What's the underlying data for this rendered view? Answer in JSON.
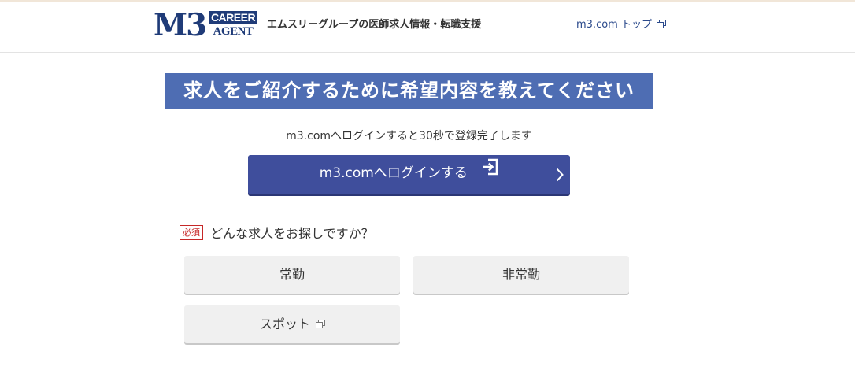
{
  "header": {
    "logo": {
      "main": "M3",
      "career": "CAREER",
      "agent": "AGENT"
    },
    "tagline": "エムスリーグループの医師求人情報・転職支援",
    "top_link": "m3.com トップ"
  },
  "banner": {
    "title": "求人をご紹介するために希望内容を教えてください"
  },
  "login": {
    "note": "m3.comへログインすると30秒で登録完了します",
    "button_label": "m3.comへログインする"
  },
  "question": {
    "required_badge": "必須",
    "text": "どんな求人をお探しですか？",
    "options": [
      {
        "label": "常勤"
      },
      {
        "label": "非常勤"
      },
      {
        "label": "スポット"
      }
    ]
  },
  "colors": {
    "brand_navy": "#1f3b78",
    "banner_blue": "#4e6db3",
    "login_button": "#3f4e9c",
    "required_red": "#c62828",
    "option_bg": "#f0f0f0"
  },
  "icons": [
    "external-link-icon",
    "login-icon",
    "chevron-right-icon"
  ]
}
